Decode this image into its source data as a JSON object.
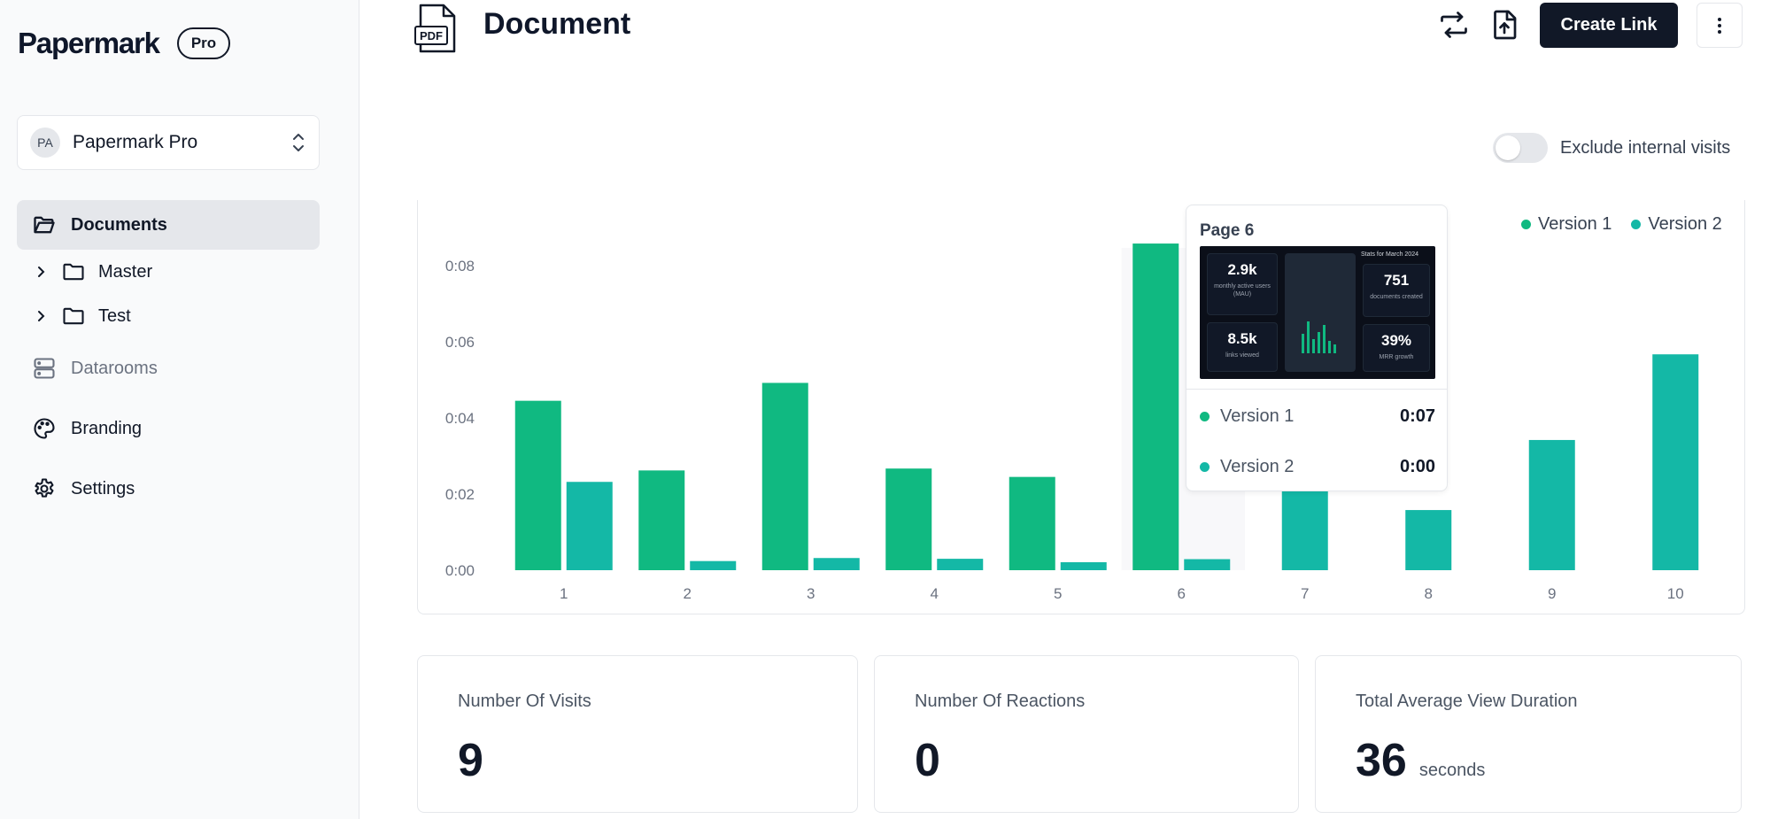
{
  "app": {
    "brand": "Papermark",
    "plan_badge": "Pro"
  },
  "team": {
    "initials": "PA",
    "name": "Papermark Pro"
  },
  "sidebar": {
    "documents": "Documents",
    "folders": [
      {
        "label": "Master"
      },
      {
        "label": "Test"
      }
    ],
    "datarooms": "Datarooms",
    "branding": "Branding",
    "settings": "Settings"
  },
  "header": {
    "doc_type": "PDF",
    "title": "Document",
    "create_link_label": "Create Link"
  },
  "filter": {
    "exclude_internal_label": "Exclude internal visits",
    "exclude_internal_on": false
  },
  "colors": {
    "version1": "#10b981",
    "version2": "#14b8a6",
    "dark": "#111827"
  },
  "chart_data": {
    "type": "bar",
    "categories": [
      "1",
      "2",
      "3",
      "4",
      "5",
      "6",
      "7",
      "8",
      "9",
      "10"
    ],
    "series": [
      {
        "name": "Version 1",
        "values": [
          0.0445,
          0.0262,
          0.0492,
          0.0267,
          0.0245,
          0.0858,
          null,
          null,
          null,
          null
        ]
      },
      {
        "name": "Version 2",
        "values": [
          0.0232,
          0.0024,
          0.0032,
          0.003,
          0.0021,
          0.0029,
          0.0213,
          0.0158,
          0.0342,
          0.0567
        ]
      }
    ],
    "yticks": [
      "0:00",
      "0:02",
      "0:04",
      "0:06",
      "0:08"
    ],
    "ylim": [
      0,
      0.096
    ],
    "highlighted_category": "6",
    "legend": "top-right"
  },
  "tooltip": {
    "title": "Page 6",
    "rows": [
      {
        "name": "Version 1",
        "value": "0:07"
      },
      {
        "name": "Version 2",
        "value": "0:00"
      }
    ],
    "thumb": {
      "mau": "2.9k",
      "mau_label": "monthly active users (MAU)",
      "links": "8.5k",
      "links_label": "links viewed",
      "docs": "751",
      "docs_label": "documents created",
      "mrr": "39%",
      "mrr_label": "MRR growth",
      "stats_heading": "Stats for March 2024"
    }
  },
  "stats": [
    {
      "label": "Number Of Visits",
      "value": "9",
      "unit": ""
    },
    {
      "label": "Number Of Reactions",
      "value": "0",
      "unit": ""
    },
    {
      "label": "Total Average View Duration",
      "value": "36",
      "unit": "seconds"
    }
  ]
}
